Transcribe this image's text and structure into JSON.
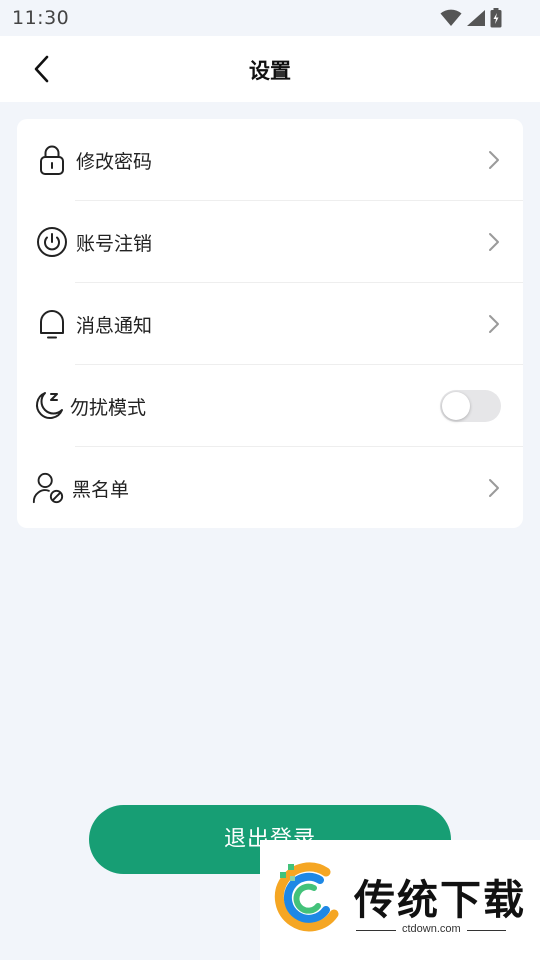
{
  "status_bar": {
    "time": "11:30"
  },
  "header": {
    "title": "设置"
  },
  "settings": {
    "change_password": "修改密码",
    "cancel_account": "账号注销",
    "notifications": "消息通知",
    "do_not_disturb": "勿扰模式",
    "do_not_disturb_on": false,
    "blacklist": "黑名单"
  },
  "logout_label": "退出登录",
  "watermark": {
    "name": "传统下载",
    "url": "ctdown.com"
  },
  "colors": {
    "accent": "#179e74",
    "background": "#f2f5fa"
  }
}
